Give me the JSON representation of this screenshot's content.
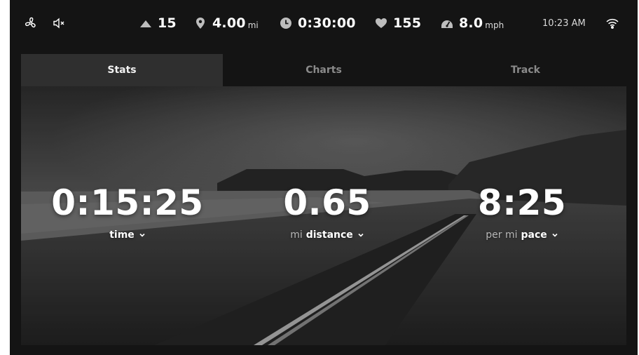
{
  "status_bar": {
    "fan_icon": "fan-icon",
    "mute_icon": "speaker-muted-icon",
    "incline": {
      "icon": "incline-icon",
      "value": "15"
    },
    "distance": {
      "icon": "location-pin-icon",
      "value": "4.00",
      "unit": "mi"
    },
    "time": {
      "icon": "clock-icon",
      "value": "0:30:00"
    },
    "heart_rate": {
      "icon": "heart-icon",
      "value": "155"
    },
    "speed": {
      "icon": "speedometer-icon",
      "value": "8.0",
      "unit": "mph"
    },
    "clock": "10:23 AM",
    "wifi_icon": "wifi-icon"
  },
  "tabs": [
    {
      "label": "Stats",
      "active": true
    },
    {
      "label": "Charts",
      "active": false
    },
    {
      "label": "Track",
      "active": false
    }
  ],
  "stats": [
    {
      "value": "0:15:25",
      "unit": "",
      "name": "time"
    },
    {
      "value": "0.65",
      "unit": "mi",
      "name": "distance"
    },
    {
      "value": "8:25",
      "unit": "per mi",
      "name": "pace"
    }
  ],
  "colors": {
    "background": "#141414",
    "active_tab": "#2f2f2f",
    "inactive_tab_text": "#8a8a8a",
    "text": "#ffffff"
  }
}
